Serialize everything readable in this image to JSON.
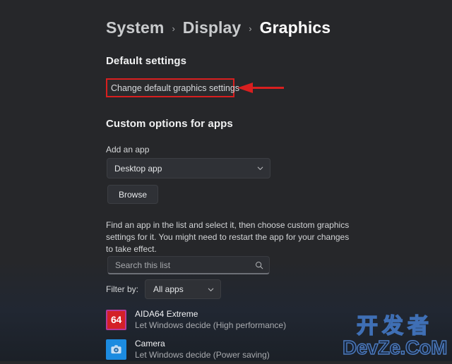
{
  "breadcrumb": {
    "items": [
      {
        "label": "System",
        "current": false
      },
      {
        "label": "Display",
        "current": false
      },
      {
        "label": "Graphics",
        "current": true
      }
    ],
    "separator": "›"
  },
  "default_settings": {
    "heading": "Default settings",
    "link_label": "Change default graphics settings",
    "highlight_color": "#d91f1f",
    "annotation": {
      "type": "arrow",
      "direction": "left",
      "color": "#d91f1f"
    }
  },
  "custom_options": {
    "heading": "Custom options for apps",
    "add_app_label": "Add an app",
    "app_type_combo": {
      "value": "Desktop app",
      "icon": "chevron-down-icon"
    },
    "browse_button": "Browse",
    "description": "Find an app in the list and select it, then choose custom graphics settings for it. You might need to restart the app for your changes to take effect.",
    "search": {
      "placeholder": "Search this list",
      "value": "",
      "icon": "search-icon"
    },
    "filter": {
      "label": "Filter by:",
      "value": "All apps",
      "icon": "chevron-down-icon"
    },
    "apps": [
      {
        "name": "AIDA64 Extreme",
        "status": "Let Windows decide (High performance)",
        "icon_name": "aida64-icon",
        "icon_text": "64",
        "icon_color": "#d42027",
        "icon_border": "#b6399a"
      },
      {
        "name": "Camera",
        "status": "Let Windows decide (Power saving)",
        "icon_name": "camera-icon",
        "icon_text": "",
        "icon_color": "#1c8be0",
        "icon_border": "#1c8be0"
      }
    ]
  },
  "watermark": {
    "chinese": "开发者",
    "latin": "DevZe.CoM"
  }
}
